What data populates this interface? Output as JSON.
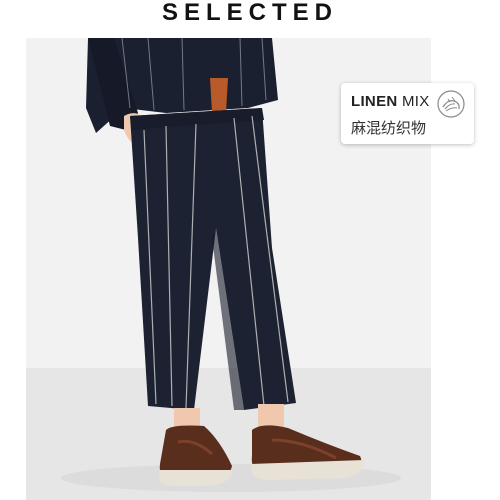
{
  "brand": {
    "name": "SELECTED"
  },
  "badge": {
    "title_strong": "LINEN",
    "title_rest": " MIX",
    "subtitle": "麻混纺织物",
    "icon": "linen-fiber-icon"
  },
  "colors": {
    "background": "#ffffff",
    "photo_background": "#ededed",
    "suit_navy": "#1d2232",
    "pinstripe": "#c8c8c8",
    "shoe_brown": "#5a2e1c",
    "sole": "#e8e2d6",
    "skin": "#f0c8ad",
    "shirt_orange": "#b85a2a"
  }
}
